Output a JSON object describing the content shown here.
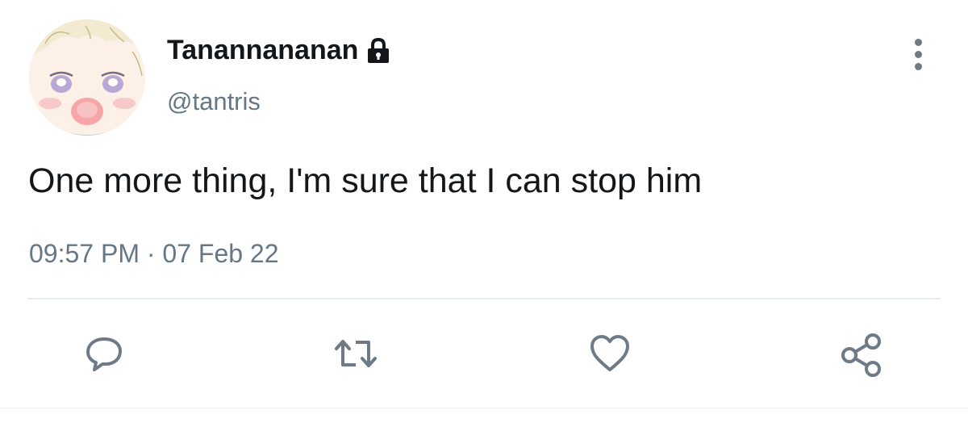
{
  "tweet": {
    "display_name": "Tanannananan",
    "handle": "@tantris",
    "text": "One more thing, I'm sure that I can stop him",
    "time": "09:57 PM",
    "separator": "·",
    "date": "07 Feb 22",
    "protected": true
  },
  "icons": {
    "lock": "lock-icon",
    "more": "more-vertical-icon",
    "reply": "reply-icon",
    "retweet": "retweet-icon",
    "like": "heart-icon",
    "share": "share-icon"
  },
  "colors": {
    "primary_text": "#14171a",
    "secondary_text": "#657786",
    "icon": "#6e7a85",
    "divider": "#e6ecf0"
  }
}
